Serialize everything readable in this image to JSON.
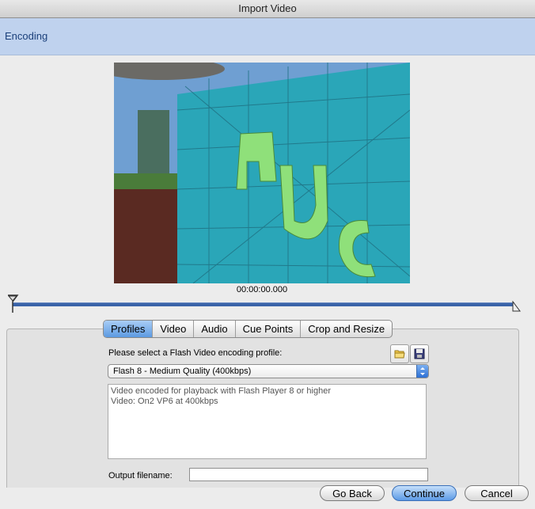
{
  "window": {
    "title": "Import Video"
  },
  "header": {
    "title": "Encoding"
  },
  "preview": {
    "timecode": "00:00:00.000"
  },
  "tabs": [
    {
      "label": "Profiles",
      "active": true
    },
    {
      "label": "Video",
      "active": false
    },
    {
      "label": "Audio",
      "active": false
    },
    {
      "label": "Cue Points",
      "active": false
    },
    {
      "label": "Crop and Resize",
      "active": false
    }
  ],
  "profiles": {
    "select_label": "Please select a Flash Video encoding profile:",
    "selected_profile": "Flash 8 - Medium Quality (400kbps)",
    "description_lines": [
      "Video encoded for playback with Flash Player 8 or higher",
      "Video: On2 VP6 at 400kbps"
    ],
    "output_label": "Output filename:",
    "output_value": ""
  },
  "buttons": {
    "go_back": "Go Back",
    "continue": "Continue",
    "cancel": "Cancel"
  },
  "icons": {
    "open_profile": "folder-icon",
    "save_profile": "save-icon"
  }
}
